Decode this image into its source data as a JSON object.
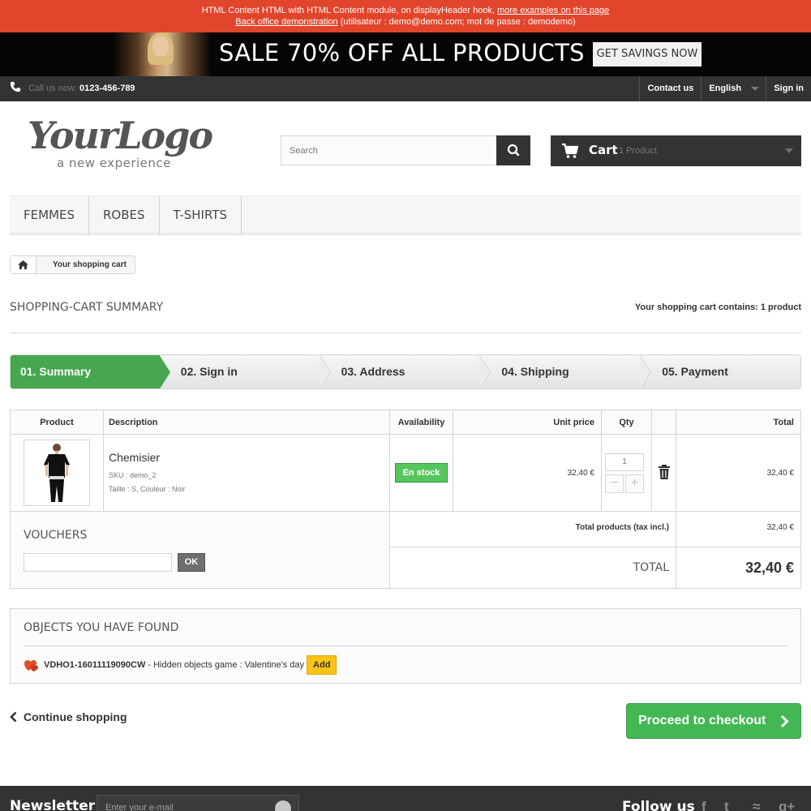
{
  "info_bar": {
    "line1_text": "HTML Content HTML with HTML Content module, on displayHeader hook,",
    "line1_link": "more examples on this page",
    "line2_link": "Back office demonstration",
    "line2_text": "(utilisateur : demo@demo.com; mot de passe : demodemo)"
  },
  "sale_banner": {
    "title": "SALE 70% OFF ALL PRODUCTS",
    "button_label": "GET SAVINGS NOW"
  },
  "top_nav": {
    "call_label": "Call us now:",
    "phone": "0123-456-789",
    "contact_label": "Contact us",
    "language": "English",
    "signin_label": "Sign in"
  },
  "header": {
    "logo_main": "YourLogo",
    "logo_sub": "a new experience",
    "search_placeholder": "Search",
    "cart_label": "Cart",
    "cart_count": "1 Product"
  },
  "menu": {
    "items": [
      "FEMMES",
      "ROBES",
      "T-SHIRTS"
    ]
  },
  "breadcrumb": {
    "current": "Your shopping cart"
  },
  "page": {
    "heading": "SHOPPING-CART SUMMARY",
    "cart_contains": "Your shopping cart contains: 1 product"
  },
  "steps": [
    "01. Summary",
    "02. Sign in",
    "03. Address",
    "04. Shipping",
    "05. Payment"
  ],
  "cart_table": {
    "headers": {
      "product": "Product",
      "description": "Description",
      "availability": "Availability",
      "unit_price": "Unit price",
      "qty": "Qty",
      "total": "Total"
    },
    "item": {
      "name": "Chemisier",
      "sku": "SKU : demo_2",
      "attributes": "Taille : S, Couleur : Noir",
      "availability": "En stock",
      "unit_price": "32,40 €",
      "qty": "1",
      "total": "32,40 €"
    },
    "vouchers_title": "VOUCHERS",
    "ok_label": "OK",
    "total_products_label": "Total products (tax incl.)",
    "total_products_value": "32,40 €",
    "total_label": "TOTAL",
    "total_value": "32,40 €"
  },
  "objects_found": {
    "title": "OBJECTS YOU HAVE FOUND",
    "code": "VDHO1-16011119090CW",
    "description": "- Hidden objects game : Valentine's day",
    "add_label": "Add"
  },
  "actions": {
    "continue_label": "Continue shopping",
    "checkout_label": "Proceed to checkout"
  },
  "footer": {
    "newsletter_label": "Newsletter",
    "newsletter_placeholder": "Enter your e-mail",
    "follow_label": "Follow us"
  },
  "colors": {
    "info_bar": "#e1452b",
    "dark": "#333333",
    "success_green": "#46a74e",
    "checkout_green": "#43b754",
    "add_yellow": "#f9c417"
  }
}
